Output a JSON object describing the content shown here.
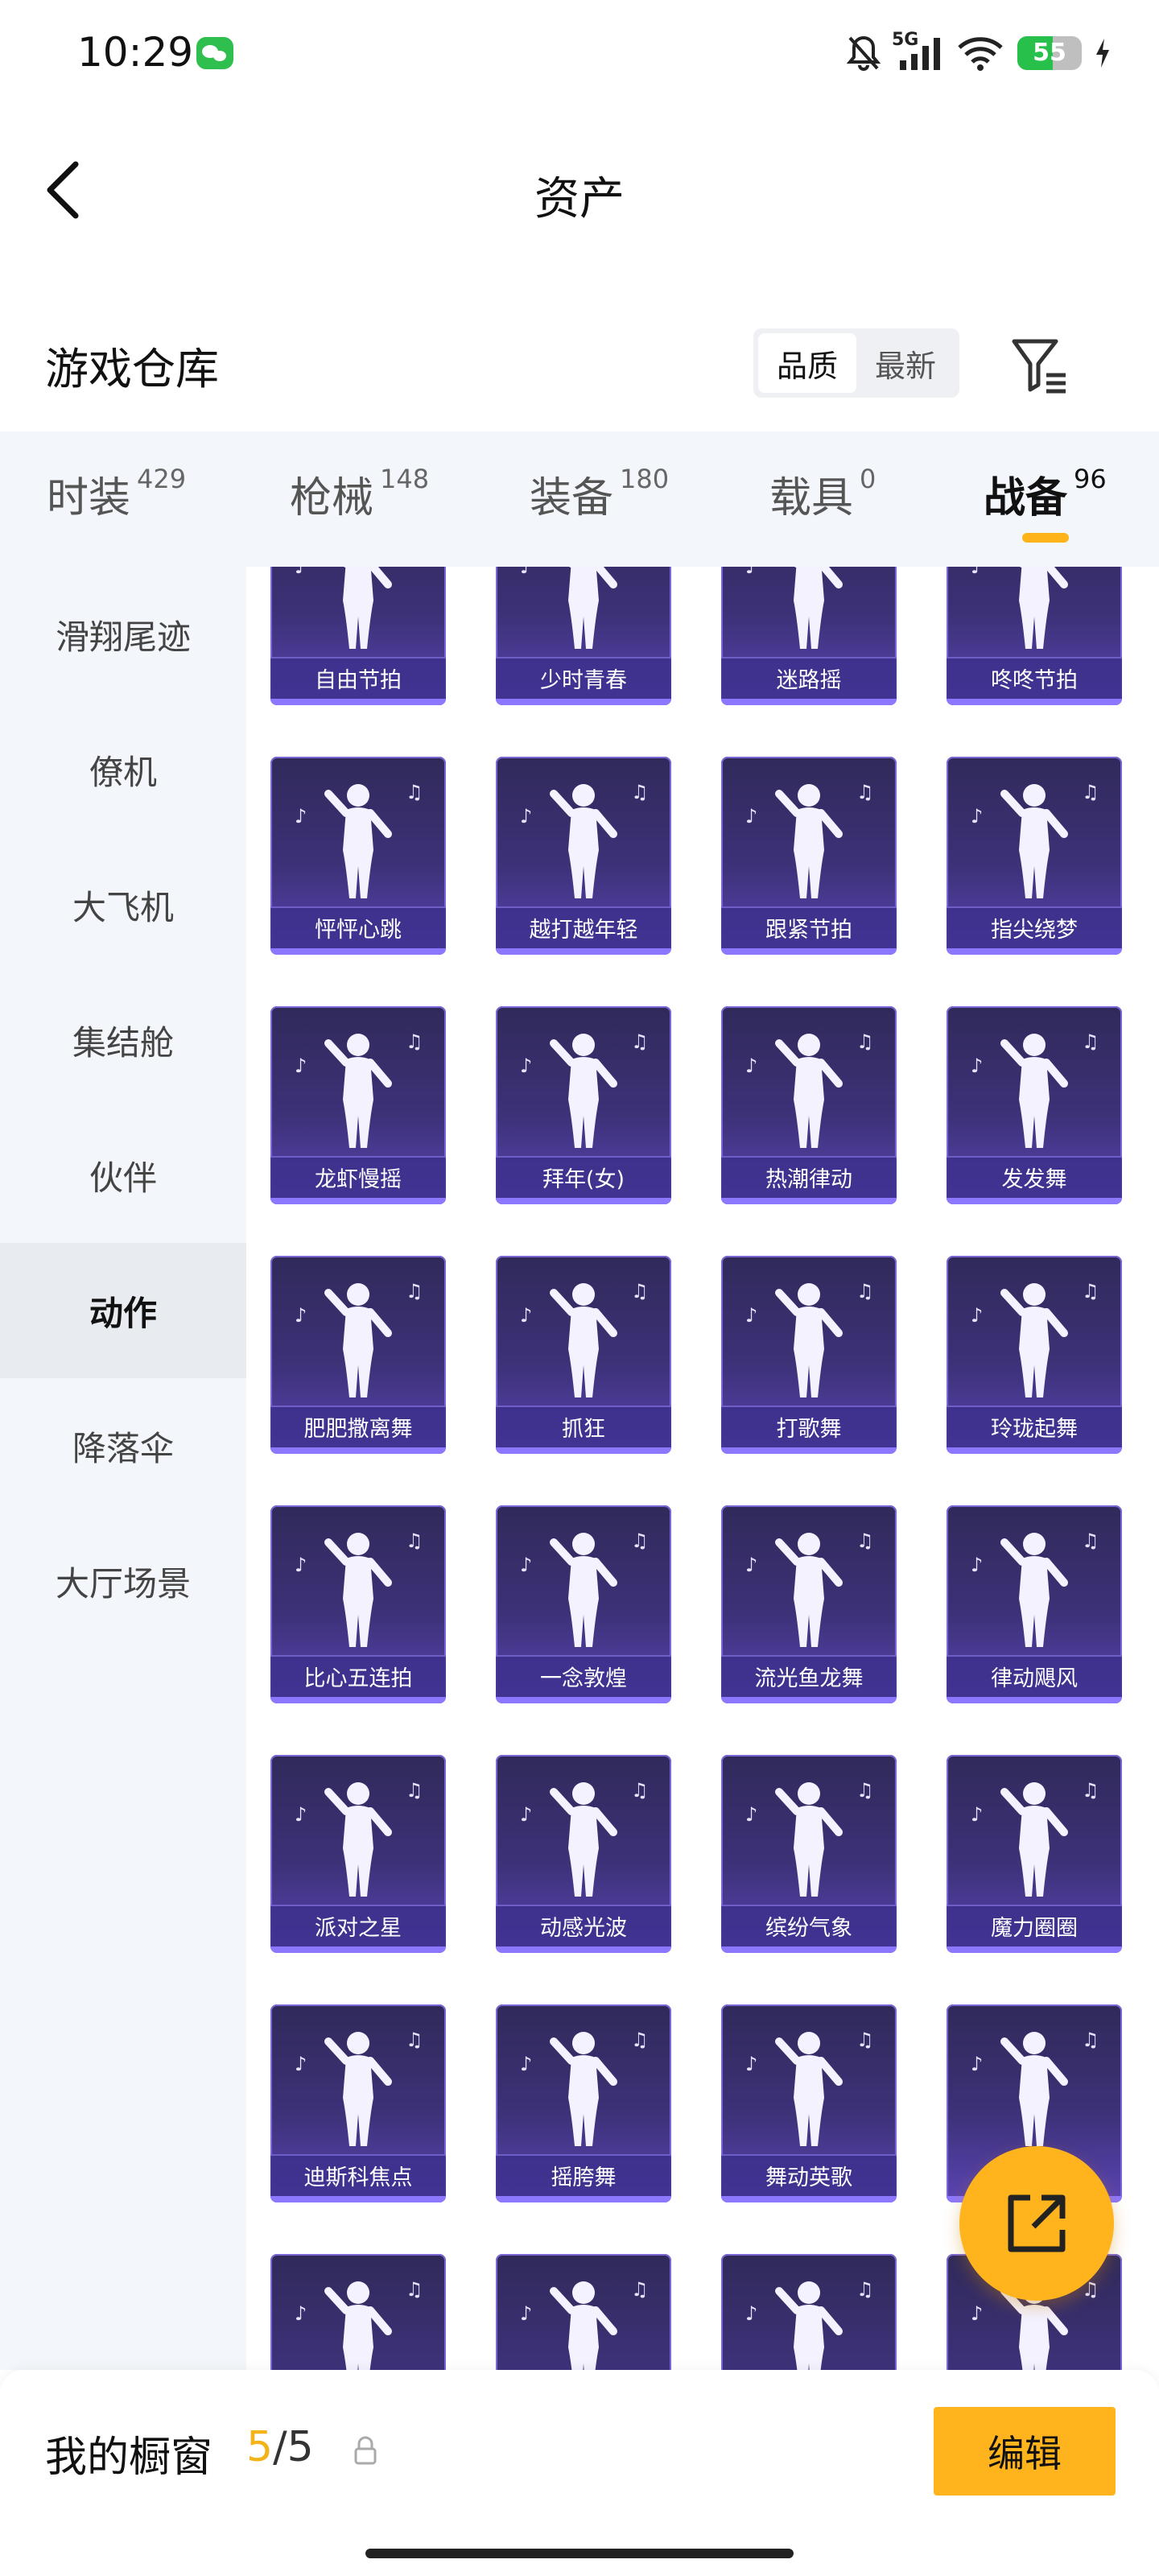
{
  "status_bar": {
    "time": "10:29",
    "network": "5G",
    "battery": "55"
  },
  "header": {
    "title": "资产"
  },
  "warehouse": {
    "title": "游戏仓库",
    "sort_options": [
      "品质",
      "最新"
    ],
    "sort_selected": "品质"
  },
  "tabs": [
    {
      "label": "时装",
      "count": "429"
    },
    {
      "label": "枪械",
      "count": "148"
    },
    {
      "label": "装备",
      "count": "180"
    },
    {
      "label": "载具",
      "count": "0"
    },
    {
      "label": "战备",
      "count": "96"
    }
  ],
  "tabs_active": "战备",
  "sidebar": {
    "items": [
      "滑翔尾迹",
      "僚机",
      "大飞机",
      "集结舱",
      "伙伴",
      "动作",
      "降落伞",
      "大厅场景"
    ],
    "active": "动作"
  },
  "grid": {
    "items": [
      "自由节拍",
      "少时青春",
      "迷路摇",
      "咚咚节拍",
      "怦怦心跳",
      "越打越年轻",
      "跟紧节拍",
      "指尖绕梦",
      "龙虾慢摇",
      "拜年(女)",
      "热潮律动",
      "发发舞",
      "肥肥撒离舞",
      "抓狂",
      "打歌舞",
      "玲珑起舞",
      "比心五连拍",
      "一念敦煌",
      "流光鱼龙舞",
      "律动飓风",
      "派对之星",
      "动感光波",
      "缤纷气象",
      "魔力圈圈",
      "迪斯科焦点",
      "摇胯舞",
      "舞动英歌",
      "",
      "",
      "",
      "",
      ""
    ]
  },
  "showcase": {
    "label": "我的橱窗",
    "used": "5",
    "total": "/5",
    "edit_label": "编辑"
  }
}
